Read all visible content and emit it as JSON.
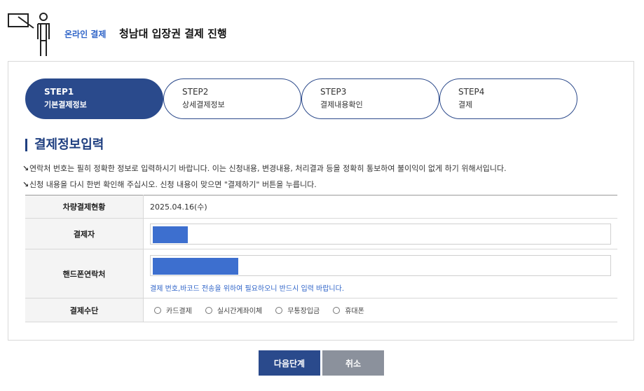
{
  "header": {
    "subtitle": "온라인 결제",
    "title": "청남대 입장권 결제 진행"
  },
  "steps": [
    {
      "num": "STEP1",
      "label": "기본결제정보",
      "active": true
    },
    {
      "num": "STEP2",
      "label": "상세결제정보",
      "active": false
    },
    {
      "num": "STEP3",
      "label": "결제내용확인",
      "active": false
    },
    {
      "num": "STEP4",
      "label": "결제",
      "active": false
    }
  ],
  "section": {
    "title": "결제정보입력",
    "notices": [
      "연락처 번호는 필히 정확한 정보로 입력하시기 바랍니다. 이는 신청내용, 변경내용, 처리결과 등을 정확히 통보하여 불이익이 없게 하기 위해서입니다.",
      "신청 내용을 다시 한번 확인해 주십시오. 신청 내용이 맞으면 \"결제하기\" 버튼을 누릅니다."
    ]
  },
  "form": {
    "date_label": "차량결제현황",
    "date_value": "2025.04.16(수)",
    "payer_label": "결제자",
    "phone_label": "핸드폰연락처",
    "phone_hint": "결제 번호,바코드 전송을 위하여 필요하오니 반드시 입력 바랍니다.",
    "method_label": "결제수단",
    "method_options": [
      "카드결제",
      "실시간계좌이체",
      "무통장입금",
      "휴대폰"
    ]
  },
  "buttons": {
    "next": "다음단계",
    "cancel": "취소"
  },
  "colors": {
    "primary": "#2a4a8c",
    "accent_blue": "#2f64c8",
    "redaction_fill": "#3d6fcf",
    "cancel_gray": "#8b919c"
  }
}
